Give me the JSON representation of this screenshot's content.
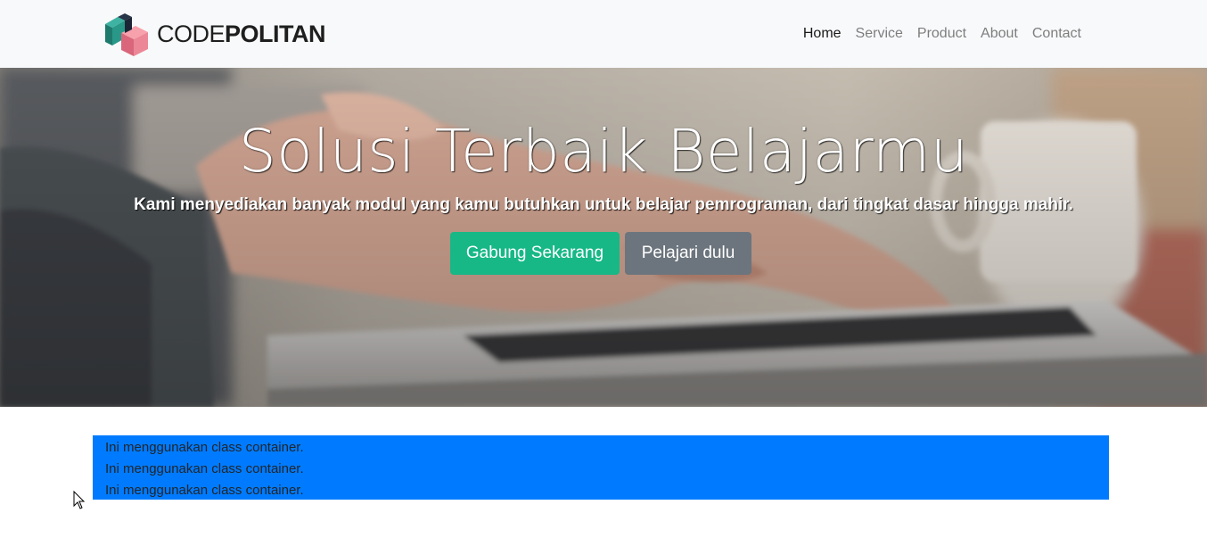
{
  "navbar": {
    "brand": {
      "light": "CODE",
      "bold": "POLITAN"
    },
    "links": [
      {
        "label": "Home",
        "active": true
      },
      {
        "label": "Service",
        "active": false
      },
      {
        "label": "Product",
        "active": false
      },
      {
        "label": "About",
        "active": false
      },
      {
        "label": "Contact",
        "active": false
      }
    ]
  },
  "hero": {
    "title": "Solusi Terbaik Belajarmu",
    "lead": "Kami menyediakan banyak modul yang kamu butuhkan untuk belajar pemrograman, dari tingkat dasar hingga mahir.",
    "primary_button": "Gabung Sekarang",
    "secondary_button": "Pelajari dulu"
  },
  "container": {
    "lines": [
      "Ini menggunakan class container.",
      "Ini menggunakan class container.",
      "Ini menggunakan class container."
    ]
  },
  "colors": {
    "navbar_bg": "#f8f9fa",
    "success": "#17b886",
    "secondary": "#6c757d",
    "container_bg": "#007bff"
  }
}
